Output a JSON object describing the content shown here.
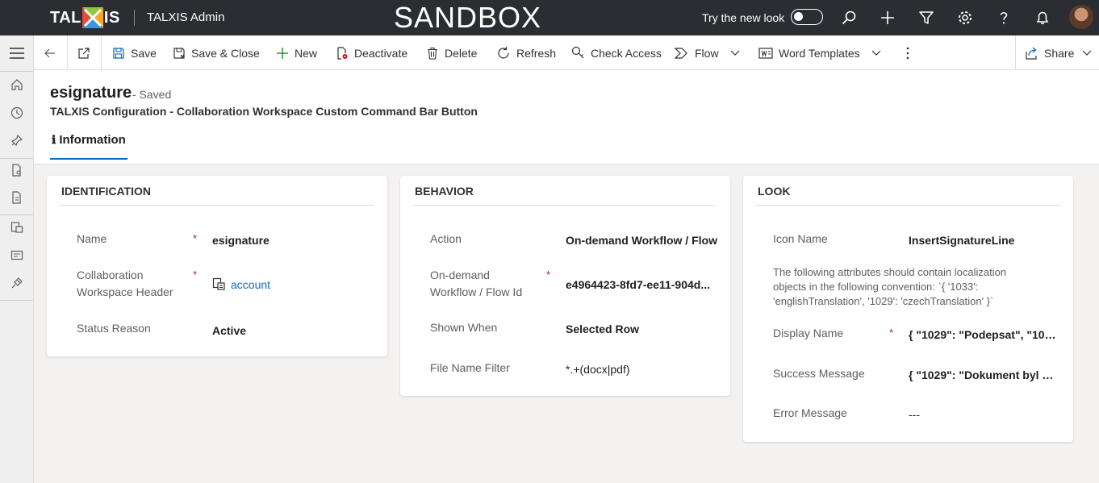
{
  "topbar": {
    "logo_left": "TAL",
    "logo_right": "IS",
    "app_title": "TALXIS Admin",
    "environment": "SANDBOX",
    "try_new_look": "Try the new look",
    "colors": {
      "bar": "#2b2d33",
      "accent": "#0f6cbd"
    }
  },
  "commandbar": {
    "save": "Save",
    "save_close": "Save & Close",
    "new": "New",
    "deactivate": "Deactivate",
    "delete": "Delete",
    "refresh": "Refresh",
    "check_access": "Check Access",
    "flow": "Flow",
    "word_templates": "Word Templates",
    "share": "Share"
  },
  "record": {
    "title": "esignature",
    "status": "- Saved",
    "entity": "TALXIS Configuration - Collaboration Workspace Custom Command Bar Button",
    "tab": "Information",
    "tab_icon": "ℹ"
  },
  "identification": {
    "title": "IDENTIFICATION",
    "name_label": "Name",
    "name_value": "esignature",
    "header_label_1": "Collaboration",
    "header_label_2": "Workspace Header",
    "header_value": "account",
    "status_label": "Status Reason",
    "status_value": "Active"
  },
  "behavior": {
    "title": "BEHAVIOR",
    "action_label": "Action",
    "action_value": "On-demand Workflow / Flow",
    "flowid_label_1": "On-demand",
    "flowid_label_2": "Workflow / Flow Id",
    "flowid_value": "e4964423-8fd7-ee11-904d...",
    "shown_label": "Shown When",
    "shown_value": "Selected Row",
    "filter_label": "File Name Filter",
    "filter_value": "*.+(docx|pdf)"
  },
  "look": {
    "title": "LOOK",
    "icon_label": "Icon Name",
    "icon_value": "InsertSignatureLine",
    "note_1": "The following attributes should contain localization",
    "note_2": "objects in the following convention: `{ '1033':",
    "note_3": "'englishTranslation', '1029': 'czechTranslation' }`",
    "display_label": "Display Name",
    "display_value": "{ \"1029\": \"Podepsat\", \"1033...",
    "success_label": "Success Message",
    "success_value": "{ \"1029\": \"Dokument byl od...",
    "error_label": "Error Message",
    "error_value": "---"
  },
  "required_mark": "*"
}
